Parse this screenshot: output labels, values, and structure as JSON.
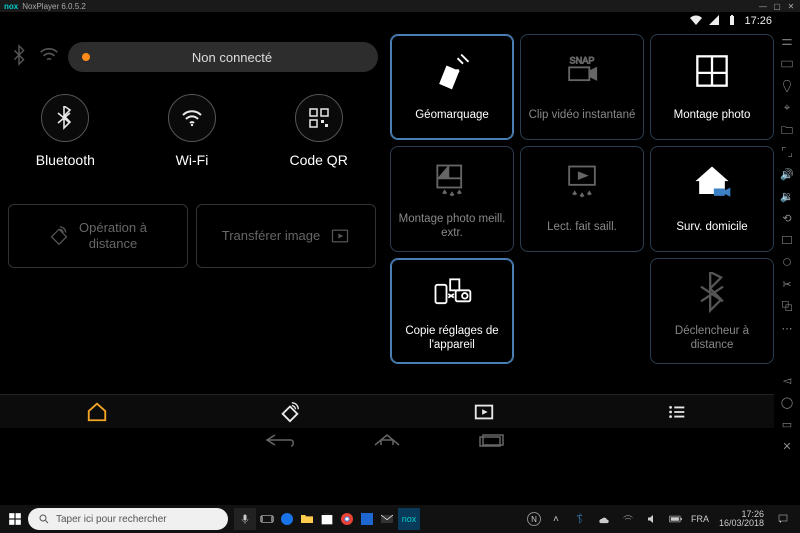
{
  "window": {
    "title": "NoxPlayer 6.0.5.2",
    "logo": "nox"
  },
  "androidStatus": {
    "time": "17:26"
  },
  "connection": {
    "statusText": "Non connecté",
    "items": [
      {
        "label": "Bluetooth",
        "icon": "bluetooth-icon"
      },
      {
        "label": "Wi-Fi",
        "icon": "wifi-icon"
      },
      {
        "label": "Code QR",
        "icon": "qr-icon"
      }
    ]
  },
  "actions": [
    {
      "label": "Opération à\ndistance",
      "icon": "remote-tag-icon"
    },
    {
      "label": "Transférer image",
      "icon": "play-box-icon"
    }
  ],
  "tiles": [
    {
      "label": "Géomarquage",
      "icon": "satellite-icon",
      "state": "bright",
      "active": true
    },
    {
      "label": "Clip vidéo instantané",
      "icon": "snap-icon",
      "state": "dim",
      "active": false
    },
    {
      "label": "Montage photo",
      "icon": "collage-icon",
      "state": "bright",
      "active": false
    },
    {
      "label": "Montage photo meill. extr.",
      "icon": "collage-stars-icon",
      "state": "dim",
      "active": false
    },
    {
      "label": "Lect. fait saill.",
      "icon": "play-stars-icon",
      "state": "dim",
      "active": false
    },
    {
      "label": "Surv. domicile",
      "icon": "home-camera-icon",
      "state": "bright",
      "active": false
    },
    {
      "label": "Copie réglages de l'appareil",
      "icon": "copy-settings-icon",
      "state": "bright",
      "active": true
    },
    {
      "label": "",
      "icon": "",
      "state": "empty",
      "active": false
    },
    {
      "label": "Déclencheur à distance",
      "icon": "bluetooth-icon",
      "state": "dim",
      "active": false
    }
  ],
  "appTabs": [
    {
      "icon": "home-icon",
      "active": true,
      "tint": "#f5a623"
    },
    {
      "icon": "remote-icon",
      "active": false,
      "tint": "#eee"
    },
    {
      "icon": "play-box-icon",
      "active": false,
      "tint": "#eee"
    },
    {
      "icon": "menu-list-icon",
      "active": false,
      "tint": "#eee"
    }
  ],
  "taskbar": {
    "searchPlaceholder": "Taper ici pour rechercher",
    "clock": {
      "time": "17:26",
      "date": "16/03/2018"
    }
  }
}
